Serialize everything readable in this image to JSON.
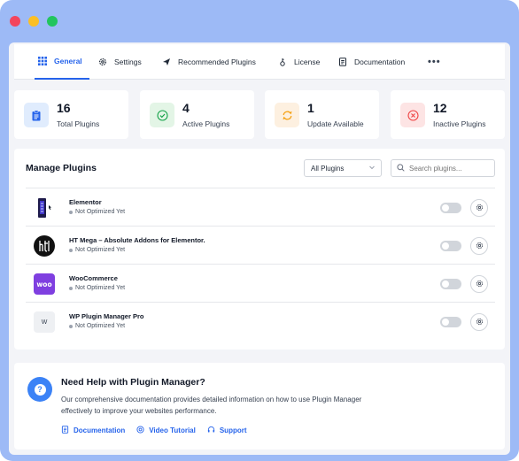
{
  "window": {
    "controls": [
      "close",
      "minimize",
      "maximize"
    ]
  },
  "tabs": [
    {
      "label": "General",
      "icon": "grid-icon",
      "active": true
    },
    {
      "label": "Settings",
      "icon": "gear-icon",
      "active": false
    },
    {
      "label": "Recommended Plugins",
      "icon": "send-icon",
      "active": false
    },
    {
      "label": "License",
      "icon": "key-icon",
      "active": false
    },
    {
      "label": "Documentation",
      "icon": "document-icon",
      "active": false
    }
  ],
  "more_label": "•••",
  "stats": [
    {
      "value": "16",
      "label": "Total Plugins",
      "icon": "clipboard-icon",
      "color": "#2563eb",
      "bg": "#e0ecfd"
    },
    {
      "value": "4",
      "label": "Active Plugins",
      "icon": "check-circle-icon",
      "color": "#16a34a",
      "bg": "#e3f5e6"
    },
    {
      "value": "1",
      "label": "Update Available",
      "icon": "refresh-icon",
      "color": "#f59e0b",
      "bg": "#fdf0e0"
    },
    {
      "value": "12",
      "label": "Inactive Plugins",
      "icon": "x-circle-icon",
      "color": "#ef4444",
      "bg": "#fde4e4"
    }
  ],
  "manage": {
    "title": "Manage Plugins",
    "filter_value": "All Plugins",
    "search_placeholder": "Search plugins...",
    "plugins": [
      {
        "name": "Elementor",
        "status": "Not Optimized Yet",
        "logo": "elementor-logo",
        "enabled": false
      },
      {
        "name": "HT Mega – Absolute Addons for Elementor.",
        "status": "Not Optimized Yet",
        "logo": "htmega-logo",
        "enabled": false
      },
      {
        "name": "WooCommerce",
        "status": "Not Optimized Yet",
        "logo": "woo-logo",
        "logo_text": "woo",
        "enabled": false
      },
      {
        "name": "WP Plugin Manager Pro",
        "status": "Not Optimized Yet",
        "logo": "wp-logo",
        "logo_text": "W",
        "enabled": false
      }
    ]
  },
  "help": {
    "title": "Need Help with Plugin Manager?",
    "description": "Our comprehensive documentation provides detailed information on how to use Plugin Manager effectively to improve your websites performance.",
    "links": [
      {
        "label": "Documentation",
        "icon": "document-icon"
      },
      {
        "label": "Video Tutorial",
        "icon": "play-circle-icon"
      },
      {
        "label": "Support",
        "icon": "headset-icon"
      }
    ]
  }
}
